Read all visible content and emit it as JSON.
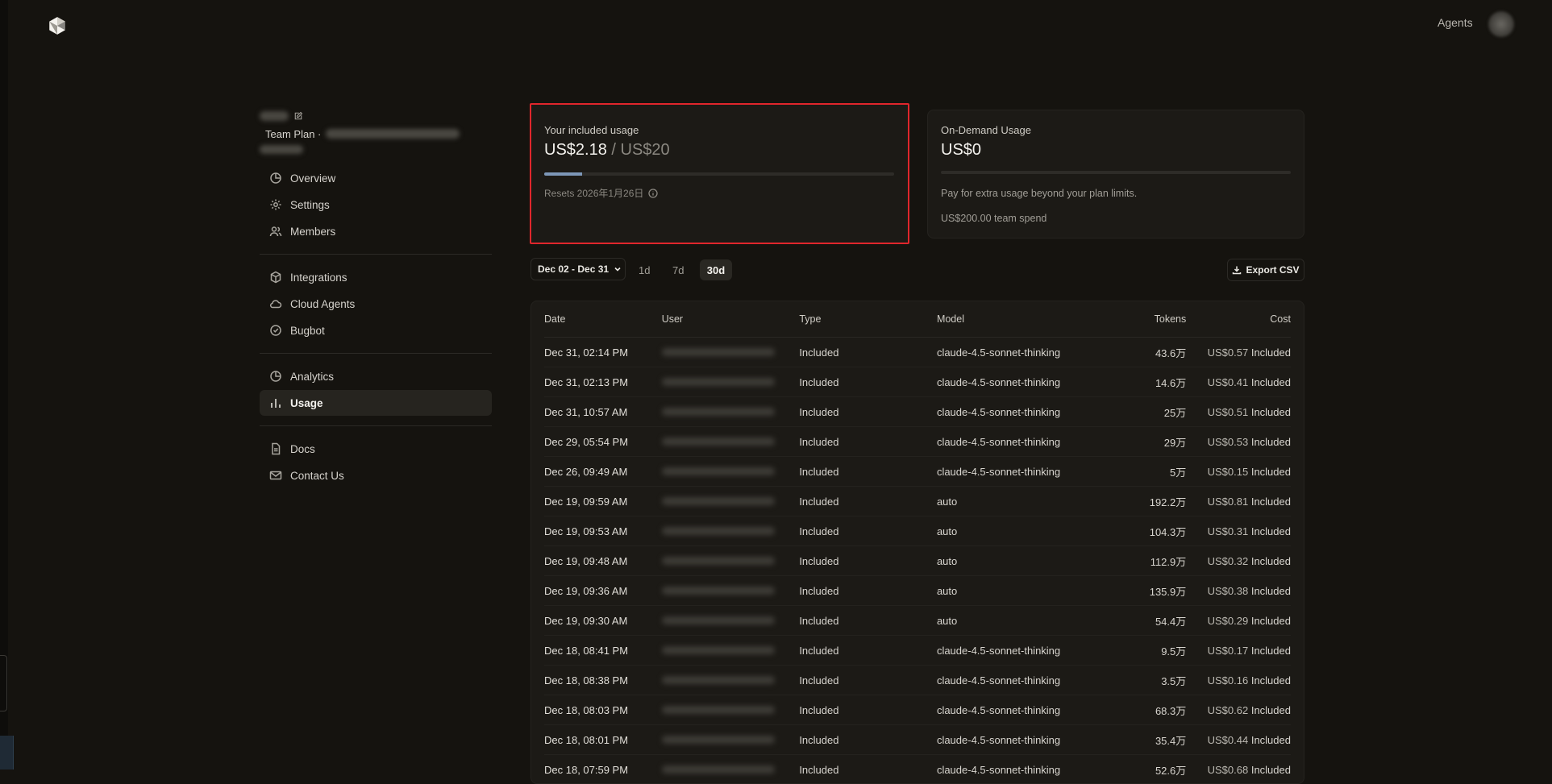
{
  "header": {
    "agents_label": "Agents"
  },
  "sidebar": {
    "team_plan_label": "Team Plan ·",
    "groups": [
      [
        {
          "label": "Overview",
          "icon": "pie-chart-icon",
          "active": false
        },
        {
          "label": "Settings",
          "icon": "gear-icon",
          "active": false
        },
        {
          "label": "Members",
          "icon": "users-icon",
          "active": false
        }
      ],
      [
        {
          "label": "Integrations",
          "icon": "cube-icon",
          "active": false
        },
        {
          "label": "Cloud Agents",
          "icon": "cloud-icon",
          "active": false
        },
        {
          "label": "Bugbot",
          "icon": "check-circle-icon",
          "active": false
        }
      ],
      [
        {
          "label": "Analytics",
          "icon": "pie-chart-icon",
          "active": false
        },
        {
          "label": "Usage",
          "icon": "bar-chart-icon",
          "active": true
        }
      ],
      [
        {
          "label": "Docs",
          "icon": "document-icon",
          "active": false
        },
        {
          "label": "Contact Us",
          "icon": "mail-icon",
          "active": false
        }
      ]
    ]
  },
  "included_usage": {
    "title": "Your included usage",
    "used": "US$2.18",
    "limit": "/ US$20",
    "fraction_used": 0.109,
    "resets": "Resets 2026年1月26日"
  },
  "on_demand": {
    "title": "On-Demand Usage",
    "value": "US$0",
    "fraction_used": 0,
    "description": "Pay for extra usage beyond your plan limits.",
    "team_spend": "US$200.00 team spend"
  },
  "filters": {
    "date_range": "Dec 02 - Dec 31",
    "ranges": [
      "1d",
      "7d",
      "30d"
    ],
    "active_range": "30d",
    "export_label": "Export CSV"
  },
  "table": {
    "columns": {
      "date": "Date",
      "user": "User",
      "type": "Type",
      "model": "Model",
      "tokens": "Tokens",
      "cost": "Cost"
    },
    "rows": [
      {
        "date": "Dec 31, 02:14 PM",
        "type": "Included",
        "model": "claude-4.5-sonnet-thinking",
        "tokens": "43.6万",
        "cost": "US$0.57",
        "cost_status": "Included"
      },
      {
        "date": "Dec 31, 02:13 PM",
        "type": "Included",
        "model": "claude-4.5-sonnet-thinking",
        "tokens": "14.6万",
        "cost": "US$0.41",
        "cost_status": "Included"
      },
      {
        "date": "Dec 31, 10:57 AM",
        "type": "Included",
        "model": "claude-4.5-sonnet-thinking",
        "tokens": "25万",
        "cost": "US$0.51",
        "cost_status": "Included"
      },
      {
        "date": "Dec 29, 05:54 PM",
        "type": "Included",
        "model": "claude-4.5-sonnet-thinking",
        "tokens": "29万",
        "cost": "US$0.53",
        "cost_status": "Included"
      },
      {
        "date": "Dec 26, 09:49 AM",
        "type": "Included",
        "model": "claude-4.5-sonnet-thinking",
        "tokens": "5万",
        "cost": "US$0.15",
        "cost_status": "Included"
      },
      {
        "date": "Dec 19, 09:59 AM",
        "type": "Included",
        "model": "auto",
        "tokens": "192.2万",
        "cost": "US$0.81",
        "cost_status": "Included"
      },
      {
        "date": "Dec 19, 09:53 AM",
        "type": "Included",
        "model": "auto",
        "tokens": "104.3万",
        "cost": "US$0.31",
        "cost_status": "Included"
      },
      {
        "date": "Dec 19, 09:48 AM",
        "type": "Included",
        "model": "auto",
        "tokens": "112.9万",
        "cost": "US$0.32",
        "cost_status": "Included"
      },
      {
        "date": "Dec 19, 09:36 AM",
        "type": "Included",
        "model": "auto",
        "tokens": "135.9万",
        "cost": "US$0.38",
        "cost_status": "Included"
      },
      {
        "date": "Dec 19, 09:30 AM",
        "type": "Included",
        "model": "auto",
        "tokens": "54.4万",
        "cost": "US$0.29",
        "cost_status": "Included"
      },
      {
        "date": "Dec 18, 08:41 PM",
        "type": "Included",
        "model": "claude-4.5-sonnet-thinking",
        "tokens": "9.5万",
        "cost": "US$0.17",
        "cost_status": "Included"
      },
      {
        "date": "Dec 18, 08:38 PM",
        "type": "Included",
        "model": "claude-4.5-sonnet-thinking",
        "tokens": "3.5万",
        "cost": "US$0.16",
        "cost_status": "Included"
      },
      {
        "date": "Dec 18, 08:03 PM",
        "type": "Included",
        "model": "claude-4.5-sonnet-thinking",
        "tokens": "68.3万",
        "cost": "US$0.62",
        "cost_status": "Included"
      },
      {
        "date": "Dec 18, 08:01 PM",
        "type": "Included",
        "model": "claude-4.5-sonnet-thinking",
        "tokens": "35.4万",
        "cost": "US$0.44",
        "cost_status": "Included"
      },
      {
        "date": "Dec 18, 07:59 PM",
        "type": "Included",
        "model": "claude-4.5-sonnet-thinking",
        "tokens": "52.6万",
        "cost": "US$0.68",
        "cost_status": "Included"
      }
    ]
  }
}
